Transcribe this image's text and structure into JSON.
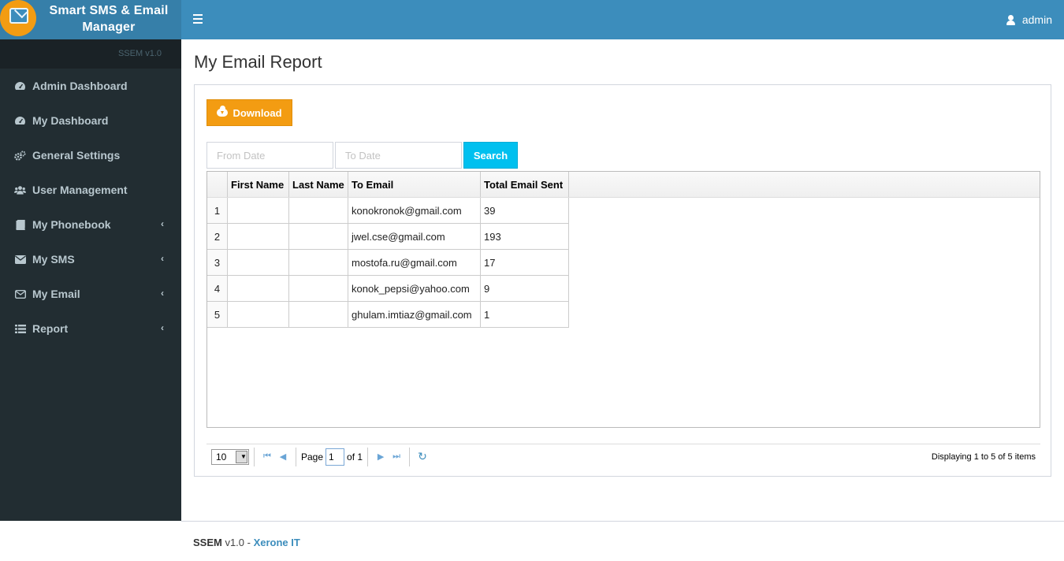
{
  "app": {
    "title_line1": "Smart SMS & Email",
    "title_line2": "Manager",
    "version_label": "SSEM v1.0"
  },
  "header": {
    "user_name": "admin"
  },
  "sidebar": {
    "items": [
      {
        "label": "Admin Dashboard",
        "icon": "dashboard-icon",
        "has_submenu": false
      },
      {
        "label": "My Dashboard",
        "icon": "dashboard-icon",
        "has_submenu": false
      },
      {
        "label": "General Settings",
        "icon": "gears-icon",
        "has_submenu": false
      },
      {
        "label": "User Management",
        "icon": "users-icon",
        "has_submenu": false
      },
      {
        "label": "My Phonebook",
        "icon": "book-icon",
        "has_submenu": true
      },
      {
        "label": "My SMS",
        "icon": "envelope-icon",
        "has_submenu": true
      },
      {
        "label": "My Email",
        "icon": "envelope-outline-icon",
        "has_submenu": true
      },
      {
        "label": "Report",
        "icon": "list-icon",
        "has_submenu": true
      }
    ]
  },
  "main": {
    "page_title": "My Email Report",
    "download_label": "Download",
    "from_date_placeholder": "From Date",
    "to_date_placeholder": "To Date",
    "search_label": "Search",
    "table": {
      "columns": [
        "",
        "First Name",
        "Last Name",
        "To Email",
        "Total Email Sent"
      ],
      "rows": [
        {
          "num": "1",
          "first": "",
          "last": "",
          "email": "konokronok@gmail.com",
          "total": "39"
        },
        {
          "num": "2",
          "first": "",
          "last": "",
          "email": "jwel.cse@gmail.com",
          "total": "193"
        },
        {
          "num": "3",
          "first": "",
          "last": "",
          "email": "mostofa.ru@gmail.com",
          "total": "17"
        },
        {
          "num": "4",
          "first": "",
          "last": "",
          "email": "konok_pepsi@yahoo.com",
          "total": "9"
        },
        {
          "num": "5",
          "first": "",
          "last": "",
          "email": "ghulam.imtiaz@gmail.com",
          "total": "1"
        }
      ]
    },
    "pager": {
      "page_size": "10",
      "page_label": "Page",
      "current_page": "1",
      "of_label": "of 1",
      "info": "Displaying 1 to 5 of 5 items"
    }
  },
  "footer": {
    "brand": "SSEM",
    "version": " v1.0 - ",
    "company": "Xerone IT"
  },
  "colors": {
    "header": "#3c8dbc",
    "logo_bg": "#367fa9",
    "sidebar": "#222d32",
    "download": "#f39c12",
    "search": "#00c0ef"
  }
}
